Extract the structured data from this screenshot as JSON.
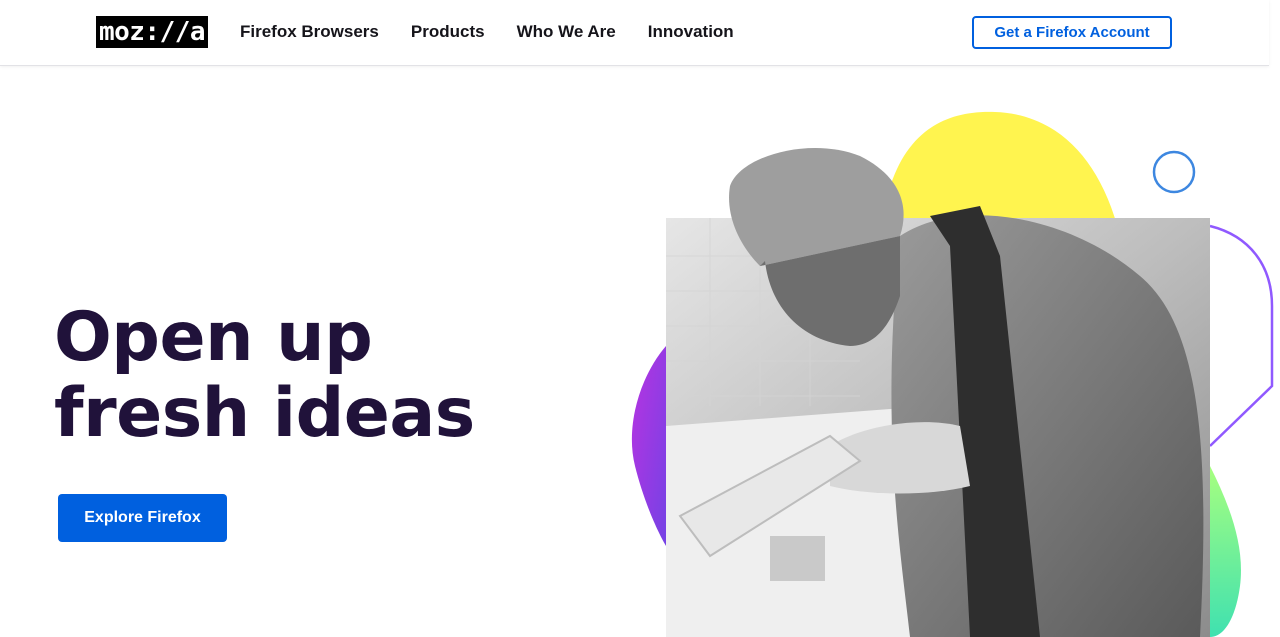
{
  "header": {
    "logo_text": "moz://a",
    "nav": [
      {
        "label": "Firefox Browsers"
      },
      {
        "label": "Products"
      },
      {
        "label": "Who We Are"
      },
      {
        "label": "Innovation"
      }
    ],
    "account_button": "Get a Firefox Account"
  },
  "hero": {
    "headline_line1": "Open up",
    "headline_line2": "fresh ideas",
    "cta_label": "Explore Firefox"
  },
  "colors": {
    "accent": "#0060df",
    "headline": "#20123a",
    "blob_yellow": "#fff44f",
    "blob_purple": "#9059ff",
    "blob_green": "#54ffbd",
    "ring_blue": "#3d87e0"
  },
  "image": {
    "description_icon": "photo-chef-slicing"
  }
}
